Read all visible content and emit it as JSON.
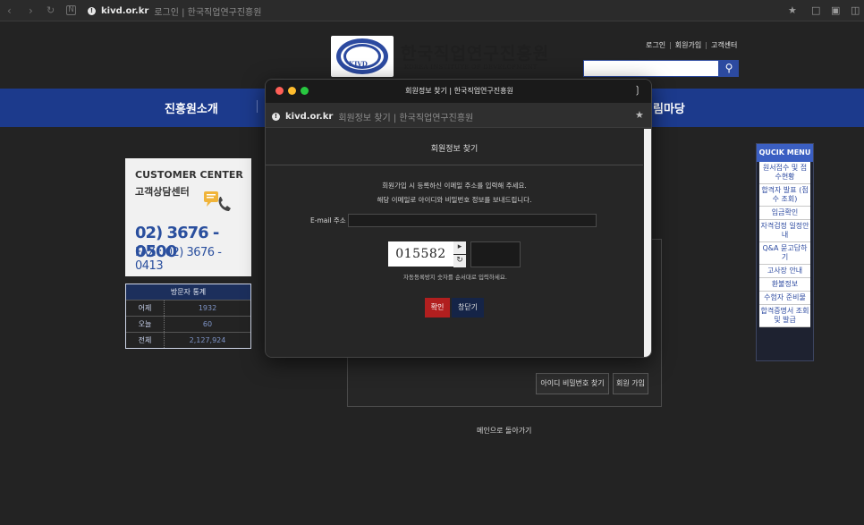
{
  "browser": {
    "host": "kivd.or.kr",
    "title": "로그인 | 한국직업연구진흥원"
  },
  "header": {
    "logo_mark": "KIVD",
    "logo_text": "한국직업연구진흥원",
    "logo_sub": "KOREA INSTITUTE OF DEVELOPMENT",
    "links": [
      "로그인",
      "회원가입",
      "고객센터"
    ]
  },
  "nav": {
    "items": [
      "진흥원소개",
      "림마당"
    ]
  },
  "customer_center": {
    "title_en": "CUSTOMER CENTER",
    "title_ko": "고객상담센터",
    "tel": "02) 3676 - 0500",
    "fax": "FAX : 02) 3676 - 0413"
  },
  "stats": {
    "title": "방문자 통계",
    "rows": [
      {
        "label": "어제",
        "value": "1932"
      },
      {
        "label": "오늘",
        "value": "60"
      },
      {
        "label": "전체",
        "value": "2,127,924"
      }
    ]
  },
  "quick_menu": {
    "title": "QUCIK MENU",
    "items": [
      "원서접수 및 접수현황",
      "합격자 발표 (점수 조회)",
      "입금확인",
      "자격검정 일정안내",
      "Q&A 묻고답하기",
      "고사장 안내",
      "환불정보",
      "수험자 준비물",
      "합격증명서 조회 및 발급"
    ]
  },
  "background_form": {
    "find_button": "아이디 비밀번호 찾기",
    "join_button": "회원 가입",
    "main_link": "메인으로 돌아가기"
  },
  "popup": {
    "window_title": "회원정보 찾기 | 한국직업연구진흥원",
    "host": "kivd.or.kr",
    "tab_title": "회원정보 찾기 | 한국직업연구진흥원",
    "heading": "회원정보 찾기",
    "desc1": "회원가입 시 등록하신 이메일 주소를 입력해 주세요.",
    "desc2": "해당 이메일로 아이디와 비밀번호 정보를 보내드립니다.",
    "email_label": "E-mail 주소",
    "email_value": "",
    "captcha_text": "015582",
    "captcha_note": "자동등록방지 숫자를 순서대로 입력하세요.",
    "ok_label": "확인",
    "close_label": "창닫기"
  },
  "colors": {
    "brand_blue": "#1c3a8c",
    "accent_red": "#b11f1f",
    "dark_navy": "#152447"
  }
}
